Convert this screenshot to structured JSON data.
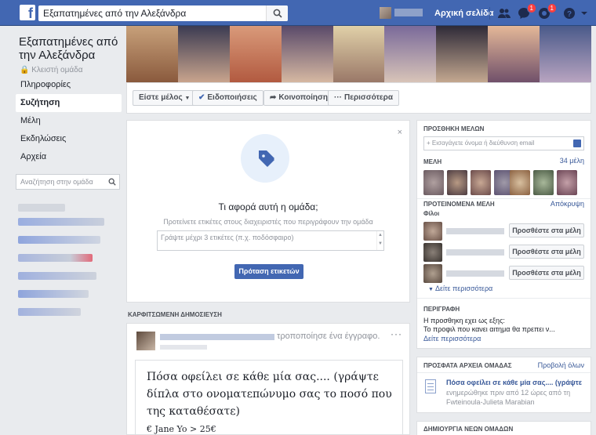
{
  "topbar": {
    "logo": "f",
    "search_value": "Εξαπατημένες από την Αλεξάνδρα",
    "home_label": "Αρχική σελίδα",
    "badges": {
      "messages": "1",
      "notifications": "1"
    }
  },
  "group": {
    "name": "Εξαπατημένες από την Αλεξάνδρα",
    "privacy": "Κλειστή ομάδα"
  },
  "nav": {
    "items": [
      {
        "label": "Πληροφορίες"
      },
      {
        "label": "Συζήτηση"
      },
      {
        "label": "Μέλη"
      },
      {
        "label": "Εκδηλώσεις"
      },
      {
        "label": "Αρχεία"
      }
    ],
    "search_placeholder": "Αναζήτηση στην ομάδα"
  },
  "actions": {
    "member": "Είστε μέλος",
    "notifications": "Ειδοποιήσεις",
    "share": "Κοινοποίηση",
    "more": "Περισσότερα"
  },
  "tags": {
    "title": "Τι αφορά αυτή η ομάδα;",
    "subtitle": "Προτείνετε ετικέτες στους διαχειριστές που περιγράφουν την ομάδα",
    "input_placeholder": "Γράψτε μέχρι 3 ετικέτες (π.χ. ποδόσφαιρο)",
    "button": "Πρόταση ετικετών",
    "close": "×"
  },
  "pinned": {
    "label": "ΚΑΡΦΙΤΣΩΜΕΝΗ ΔΗΜΟΣΙΕΥΣΗ",
    "action": "τροποποίησε ένα έγγραφο.",
    "more": "···",
    "doc_title": "Πόσα οφείλει σε κάθε μία σας.... (γράψτε δίπλα στο ονοματεπώνυμο σας το ποσό που της καταθέσατε)",
    "doc_line": "€ Jane Yo > 25€"
  },
  "right": {
    "add_members": {
      "heading": "ΠΡΟΣΘΗΚΗ ΜΕΛΩΝ",
      "placeholder": "Εισαγάγετε όνομα ή διεύθυνση email"
    },
    "members": {
      "heading": "ΜΕΛΗ",
      "count": "34 μέλη"
    },
    "suggested": {
      "heading": "ΠΡΟΤΕΙΝΟΜΕΝΑ ΜΕΛΗ",
      "hide": "Απόκρυψη",
      "friends_label": "Φίλοι",
      "add_label": "Προσθέστε στα μέλη",
      "see_more": "Δείτε περισσότερα"
    },
    "description": {
      "heading": "ΠΕΡΙΓΡΑΦΗ",
      "line1": "Η προσθηκη εχει ως εξης:",
      "line2": "Το προφιλ που κανει αιτημα θα πρεπει ν...",
      "see_more": "Δείτε περισσότερα"
    },
    "files": {
      "heading": "ΠΡΟΣΦΑΤΑ ΑΡΧΕΙΑ ΟΜΑΔΑΣ",
      "view_all": "Προβολή όλων",
      "file_title": "Πόσα οφείλει σε κάθε μία σας.... (γράψτε",
      "file_meta1": "ενημερώθηκε πριν από 12 ώρες από τη",
      "file_meta2": "Fwteinoula-Julieta Marabian"
    },
    "create": {
      "heading": "ΔΗΜΙΟΥΡΓΙΑ ΝΕΩΝ ΟΜΑΔΩΝ"
    }
  },
  "colors": {
    "brand": "#4267b2",
    "background": "#e9ebee",
    "link": "#385898",
    "badge": "#fa3e3e"
  }
}
